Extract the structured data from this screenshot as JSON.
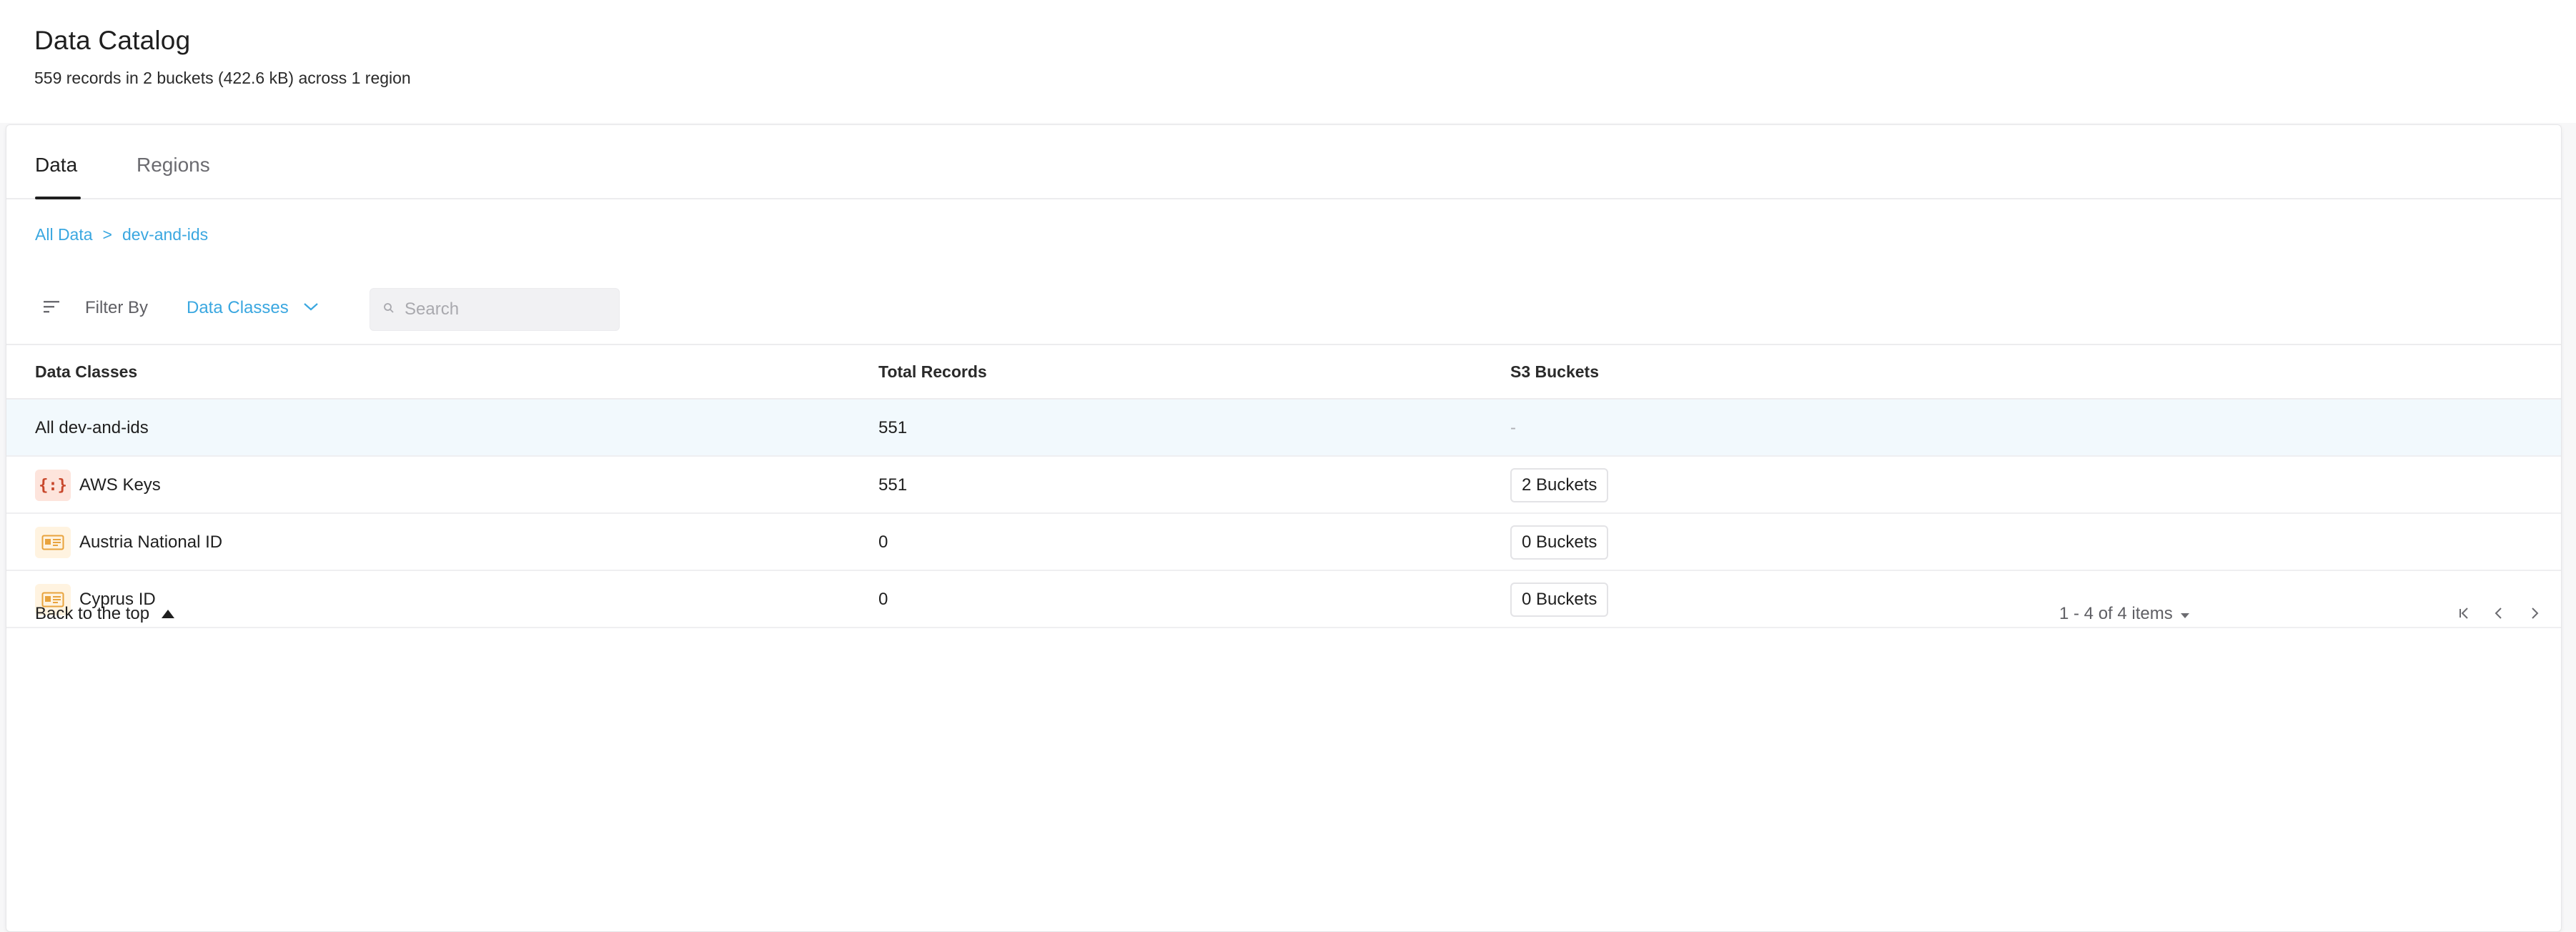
{
  "header": {
    "title": "Data Catalog",
    "summary": "559 records in 2 buckets (422.6 kB) across 1 region"
  },
  "tabs": [
    {
      "label": "Data",
      "active": true
    },
    {
      "label": "Regions",
      "active": false
    }
  ],
  "breadcrumb": {
    "root": "All Data",
    "separator": ">",
    "current": "dev-and-ids"
  },
  "filter": {
    "label": "Filter By",
    "selected": "Data Classes",
    "search_placeholder": "Search"
  },
  "table": {
    "columns": [
      "Data Classes",
      "Total Records",
      "S3 Buckets"
    ],
    "rows": [
      {
        "name": "All dev-and-ids",
        "icon": "none",
        "records": "551",
        "buckets": "-"
      },
      {
        "name": "AWS Keys",
        "icon": "code-braces-icon",
        "records": "551",
        "buckets": "2 Buckets"
      },
      {
        "name": "Austria National ID",
        "icon": "id-card-icon",
        "records": "0",
        "buckets": "0 Buckets"
      },
      {
        "name": "Cyprus ID",
        "icon": "id-card-icon",
        "records": "0",
        "buckets": "0 Buckets"
      }
    ]
  },
  "footer": {
    "back_to_top": "Back to the top",
    "page_info": "1 - 4 of 4 items"
  },
  "colors": {
    "link": "#3aa7e0",
    "highlight_row": "#f2f9fd",
    "code_icon_bg": "#fde4dc",
    "id_icon_bg": "#fff3e0"
  }
}
